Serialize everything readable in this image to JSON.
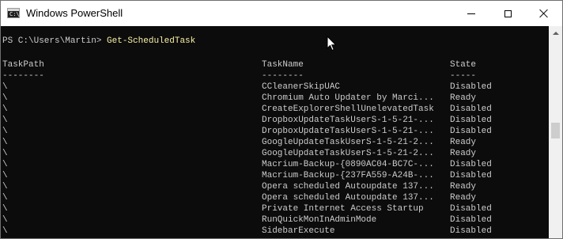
{
  "window": {
    "title": "Windows PowerShell",
    "app_icon_glyph": "C:\\",
    "icon": "powershell-icon"
  },
  "prompt": {
    "path": "PS C:\\Users\\Martin> ",
    "command": "Get-ScheduledTask"
  },
  "table": {
    "columns": [
      "TaskPath",
      "TaskName",
      "State"
    ],
    "separators": [
      "--------",
      "--------",
      "-----"
    ],
    "rows": [
      {
        "path": "\\",
        "name": "CCleanerSkipUAC",
        "state": "Disabled"
      },
      {
        "path": "\\",
        "name": "Chromium Auto Updater by Marci...",
        "state": "Ready"
      },
      {
        "path": "\\",
        "name": "CreateExplorerShellUnelevatedTask",
        "state": "Disabled"
      },
      {
        "path": "\\",
        "name": "DropboxUpdateTaskUserS-1-5-21-...",
        "state": "Disabled"
      },
      {
        "path": "\\",
        "name": "DropboxUpdateTaskUserS-1-5-21-...",
        "state": "Disabled"
      },
      {
        "path": "\\",
        "name": "GoogleUpdateTaskUserS-1-5-21-2...",
        "state": "Ready"
      },
      {
        "path": "\\",
        "name": "GoogleUpdateTaskUserS-1-5-21-2...",
        "state": "Ready"
      },
      {
        "path": "\\",
        "name": "Macrium-Backup-{0890AC04-BC7C-...",
        "state": "Disabled"
      },
      {
        "path": "\\",
        "name": "Macrium-Backup-{237FA559-A24B-...",
        "state": "Disabled"
      },
      {
        "path": "\\",
        "name": "Opera scheduled Autoupdate 137...",
        "state": "Ready"
      },
      {
        "path": "\\",
        "name": "Opera scheduled Autoupdate 137...",
        "state": "Ready"
      },
      {
        "path": "\\",
        "name": "Private Internet Access Startup",
        "state": "Disabled"
      },
      {
        "path": "\\",
        "name": "RunQuickMonInAdminMode",
        "state": "Disabled"
      },
      {
        "path": "\\",
        "name": "SidebarExecute",
        "state": "Disabled"
      }
    ]
  },
  "colors": {
    "console_bg": "#0c0c0c",
    "console_fg": "#cccccc",
    "command_fg": "#f9f1a5",
    "titlebar_bg": "#ffffff"
  }
}
